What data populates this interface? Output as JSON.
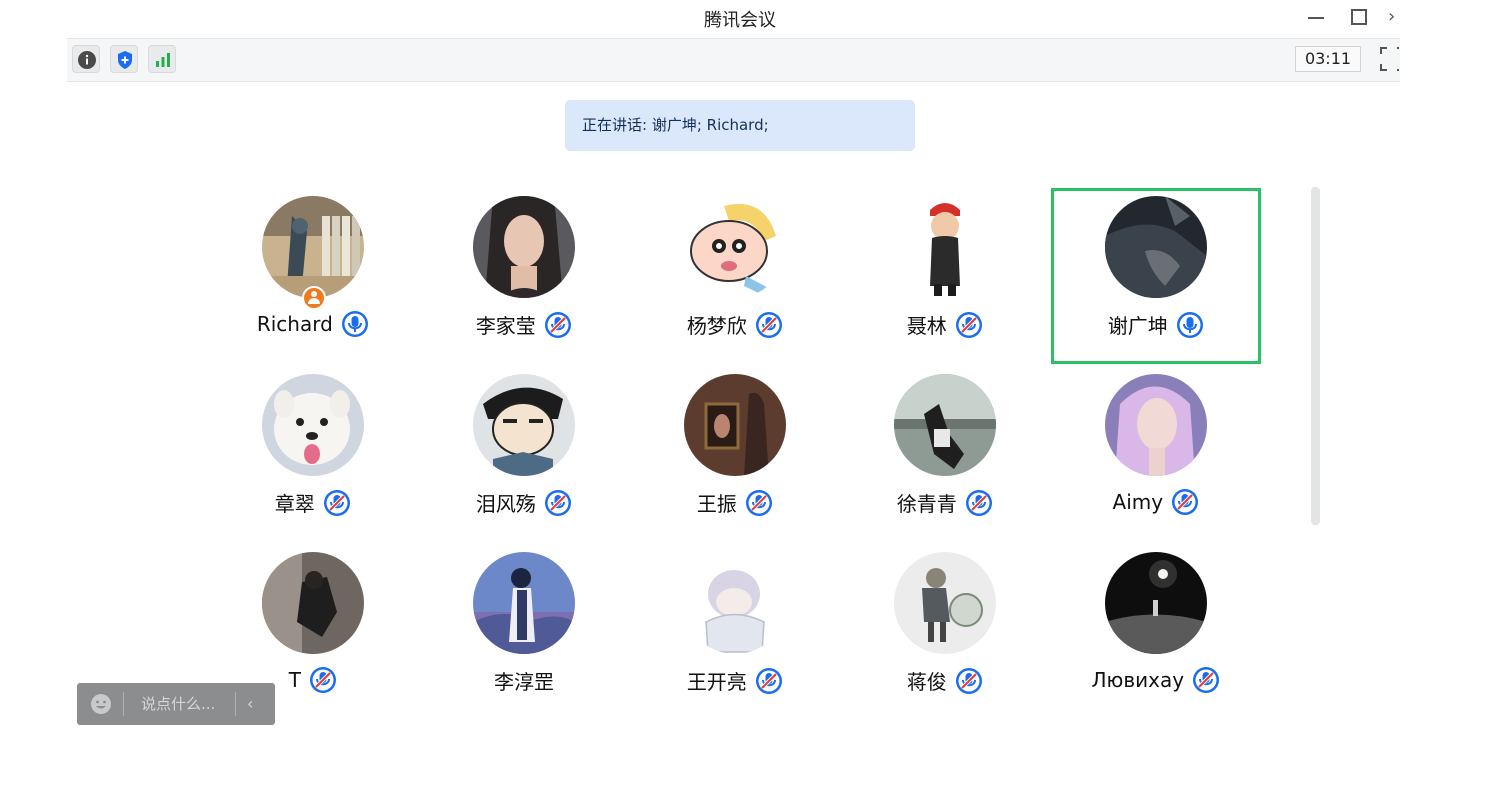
{
  "window": {
    "title": "腾讯会议",
    "close_glyph": "›"
  },
  "toolbar": {
    "timer": "03:11",
    "icons": [
      "info-icon",
      "shield-icon",
      "signal-icon",
      "fullscreen-icon"
    ]
  },
  "speaking_banner": {
    "text": "正在讲话: 谢广坤; Richard;"
  },
  "participants": [
    {
      "name": "Richard",
      "mic": "active",
      "host": true
    },
    {
      "name": "李家莹",
      "mic": "muted"
    },
    {
      "name": "杨梦欣",
      "mic": "muted"
    },
    {
      "name": "聂林",
      "mic": "muted"
    },
    {
      "name": "谢广坤",
      "mic": "active",
      "speaking": true
    },
    {
      "name": "章翠",
      "mic": "muted"
    },
    {
      "name": "泪风殇",
      "mic": "muted"
    },
    {
      "name": "王振",
      "mic": "muted"
    },
    {
      "name": "徐青青",
      "mic": "muted"
    },
    {
      "name": "Aimy",
      "mic": "muted"
    },
    {
      "name": "T",
      "mic": "muted"
    },
    {
      "name": "李淳罡",
      "mic": "none"
    },
    {
      "name": "王开亮",
      "mic": "muted"
    },
    {
      "name": "蒋俊",
      "mic": "muted"
    },
    {
      "name": "Лювихау",
      "mic": "muted"
    }
  ],
  "chat": {
    "placeholder": "说点什么...",
    "collapse_glyph": "‹"
  },
  "colors": {
    "accent_blue": "#1a6cf0",
    "speaking_outline": "#2ac066",
    "banner_bg": "#dbe8fb",
    "host_badge": "#f07b1e"
  }
}
